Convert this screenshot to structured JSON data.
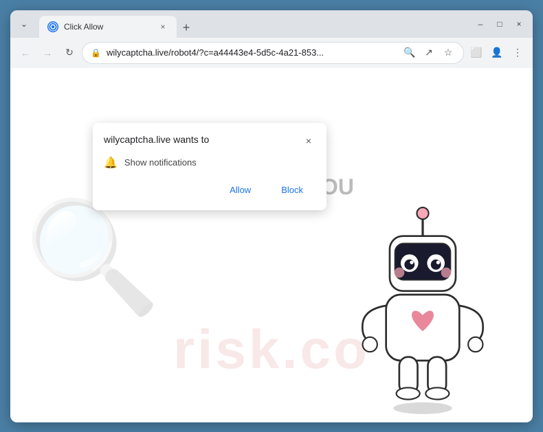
{
  "browser": {
    "tab": {
      "favicon_text": "C",
      "title": "Click Allow",
      "close_label": "×"
    },
    "new_tab_label": "+",
    "window_controls": {
      "minimize": "–",
      "maximize": "□",
      "close": "×",
      "chevron_down": "⌄"
    },
    "nav": {
      "back_label": "←",
      "forward_label": "→",
      "reload_label": "↻",
      "address": "wilycaptcha.live/robot4/?c=a44443e4-5d5c-4a21-853...",
      "lock_icon": "🔒"
    },
    "nav_icons": {
      "search": "🔍",
      "share": "↗",
      "bookmark": "☆",
      "split": "⬜",
      "profile": "👤",
      "menu": "⋮"
    }
  },
  "dialog": {
    "title": "wilycaptcha.live wants to",
    "close_label": "×",
    "permission_label": "Show notifications",
    "allow_label": "Allow",
    "block_label": "Block"
  },
  "page": {
    "partial_text": "OU",
    "watermark": "risk.co"
  }
}
